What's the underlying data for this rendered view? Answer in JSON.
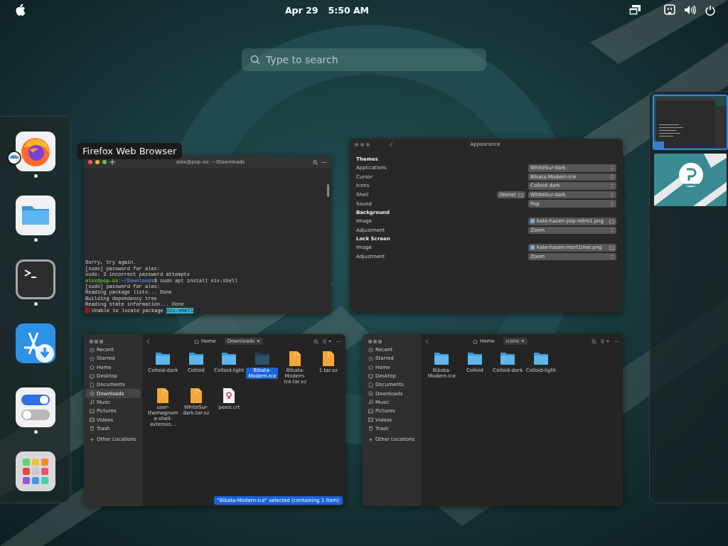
{
  "top_bar": {
    "date": "Apr 29",
    "time": "5:50 AM"
  },
  "search": {
    "placeholder": "Type to search"
  },
  "dock": {
    "tooltip": "Firefox Web Browser",
    "items": [
      {
        "kind": "browser",
        "running": true
      },
      {
        "kind": "files",
        "running": true
      },
      {
        "kind": "terminal",
        "running": true
      },
      {
        "kind": "store",
        "running": false
      },
      {
        "kind": "settings",
        "running": true
      },
      {
        "kind": "grid",
        "running": false
      }
    ]
  },
  "terminal": {
    "title": "alex@pop-os: ~/Downloads",
    "lines": [
      {
        "kind": "plain",
        "text": "Sorry, try again."
      },
      {
        "kind": "plain",
        "text": "[sudo] password for alex:"
      },
      {
        "kind": "plain",
        "text": "sudo: 3 incorrect password attempts"
      },
      {
        "kind": "prompt",
        "user": "alex@pop-os",
        "path": ":~/Downloads",
        "text": "$ sudo apt install nix-shell"
      },
      {
        "kind": "plain",
        "text": "[sudo] password for alex:"
      },
      {
        "kind": "plain",
        "text": "Reading package lists... Done"
      },
      {
        "kind": "plain",
        "text": "Building dependency tree"
      },
      {
        "kind": "plain",
        "text": "Reading state information... Done"
      },
      {
        "kind": "error",
        "text": "Unable to locate package ",
        "highlight": "nix-shell"
      }
    ]
  },
  "appearance": {
    "title": "Appearance",
    "sections": [
      {
        "heading": "Themes",
        "rows": [
          {
            "kind": "select",
            "label": "Applications",
            "value": "WhiteSur-dark"
          },
          {
            "kind": "select",
            "label": "Cursor",
            "value": "Bibata-Modern-Ice"
          },
          {
            "kind": "select",
            "label": "Icons",
            "value": "Colloid-dark"
          },
          {
            "kind": "select",
            "label": "Shell",
            "value": "WhiteSur-dark",
            "extra": "(None)"
          },
          {
            "kind": "select",
            "label": "Sound",
            "value": "Pop"
          }
        ]
      },
      {
        "heading": "Background",
        "rows": [
          {
            "kind": "file",
            "label": "Image",
            "value": "kate-hazen-pop-retro1.png"
          },
          {
            "kind": "select",
            "label": "Adjustment",
            "value": "Zoom"
          }
        ]
      },
      {
        "heading": "Lock Screen",
        "rows": [
          {
            "kind": "file",
            "label": "Image",
            "value": "kate-hazen-mort1mer.png"
          },
          {
            "kind": "select",
            "label": "Adjustment",
            "value": "Zoom"
          }
        ]
      }
    ]
  },
  "files": [
    {
      "home": "Home",
      "folder": "Downloads",
      "other_locations": "Other Locations",
      "status": "\"Bibata-Modern-Ice\" selected (containing 1 item)",
      "sidebar": [
        {
          "kind": "recent",
          "label": "Recent",
          "selected": false
        },
        {
          "kind": "starred",
          "label": "Starred",
          "selected": false
        },
        {
          "kind": "home",
          "label": "Home",
          "selected": false
        },
        {
          "kind": "desktop",
          "label": "Desktop",
          "selected": false
        },
        {
          "kind": "documents",
          "label": "Documents",
          "selected": false
        },
        {
          "kind": "downloads",
          "label": "Downloads",
          "selected": true
        },
        {
          "kind": "music",
          "label": "Music",
          "selected": false
        },
        {
          "kind": "pictures",
          "label": "Pictures",
          "selected": false
        },
        {
          "kind": "videos",
          "label": "Videos",
          "selected": false
        },
        {
          "kind": "trash",
          "label": "Trash",
          "selected": false
        }
      ],
      "items": [
        {
          "kind": "folder",
          "name": "Colloid-dark",
          "selected": false
        },
        {
          "kind": "folder",
          "name": "Colloid",
          "selected": false
        },
        {
          "kind": "folder",
          "name": "Colloid-light",
          "selected": false
        },
        {
          "kind": "folder",
          "name": "Bibata-Modern-Ice",
          "selected": true
        },
        {
          "kind": "archive",
          "name": "Bibata-Modern-Ice.tar.xz",
          "selected": false
        },
        {
          "kind": "archive",
          "name": "1.tar.xz",
          "selected": false
        },
        {
          "kind": "archive",
          "name": "user-themegnome-shell-extensio…",
          "selected": false
        },
        {
          "kind": "archive",
          "name": "WhiteSur-dark.tar.xz",
          "selected": false
        },
        {
          "kind": "certificate",
          "name": "pexis.crt",
          "selected": false
        }
      ]
    },
    {
      "home": "Home",
      "folder": "icons",
      "other_locations": "Other Locations",
      "sidebar": [
        {
          "kind": "recent",
          "label": "Recent",
          "selected": false
        },
        {
          "kind": "starred",
          "label": "Starred",
          "selected": false
        },
        {
          "kind": "home",
          "label": "Home",
          "selected": false
        },
        {
          "kind": "desktop",
          "label": "Desktop",
          "selected": false
        },
        {
          "kind": "documents",
          "label": "Documents",
          "selected": false
        },
        {
          "kind": "downloads",
          "label": "Downloads",
          "selected": false
        },
        {
          "kind": "music",
          "label": "Music",
          "selected": false
        },
        {
          "kind": "pictures",
          "label": "Pictures",
          "selected": false
        },
        {
          "kind": "videos",
          "label": "Videos",
          "selected": false
        },
        {
          "kind": "trash",
          "label": "Trash",
          "selected": false
        }
      ],
      "items": [
        {
          "kind": "folder",
          "name": "Bibata-Modern-Ice",
          "selected": false
        },
        {
          "kind": "folder",
          "name": "Colloid",
          "selected": false
        },
        {
          "kind": "folder",
          "name": "Colloid-dark",
          "selected": false
        },
        {
          "kind": "folder",
          "name": "Colloid-light",
          "selected": false
        }
      ]
    }
  ],
  "workspaces": [
    {
      "kind": "windows",
      "selected": true
    },
    {
      "kind": "wallpaper",
      "selected": false
    }
  ]
}
